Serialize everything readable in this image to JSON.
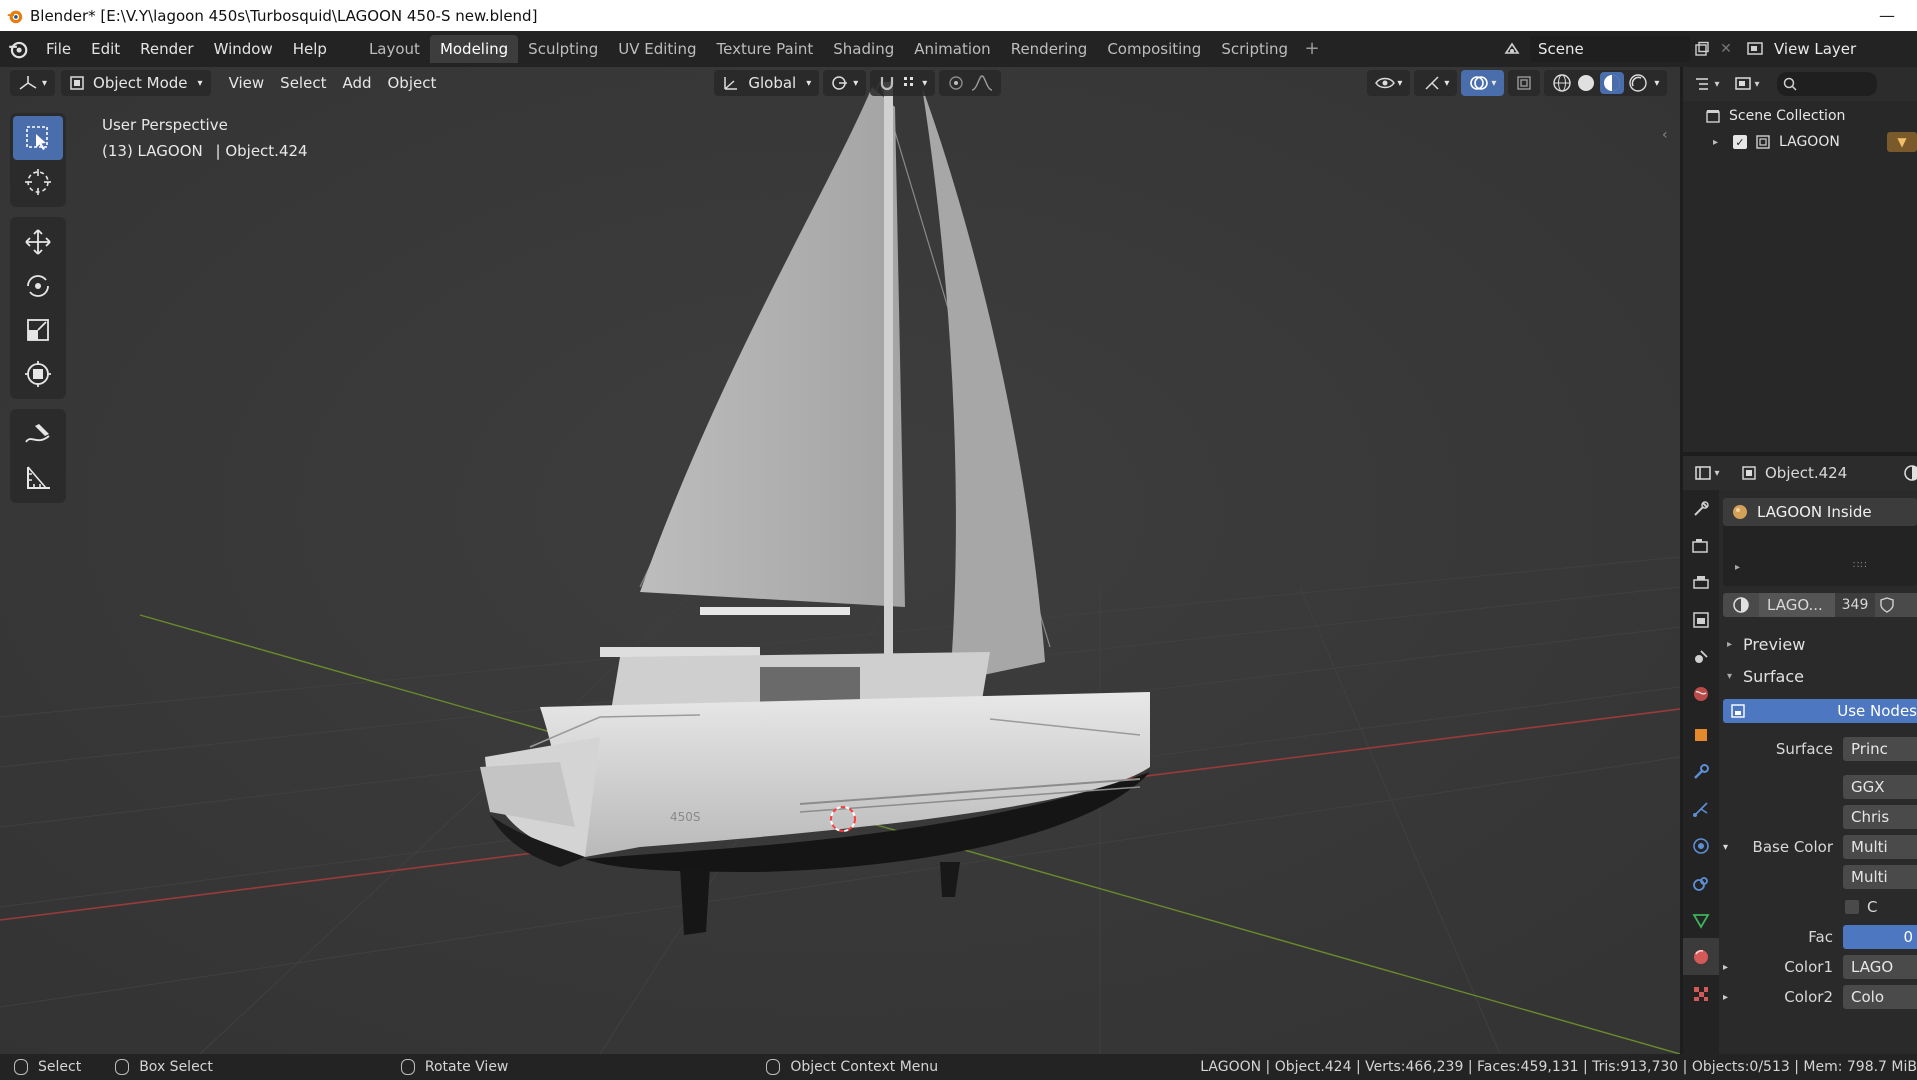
{
  "window": {
    "title": "Blender* [E:\\V.Y\\lagoon 450s\\Turbosquid\\LAGOON  450-S new.blend]",
    "minimize": "—"
  },
  "menu": [
    "File",
    "Edit",
    "Render",
    "Window",
    "Help"
  ],
  "workspaces": [
    {
      "label": "Layout",
      "active": false
    },
    {
      "label": "Modeling",
      "active": true
    },
    {
      "label": "Sculpting",
      "active": false
    },
    {
      "label": "UV Editing",
      "active": false
    },
    {
      "label": "Texture Paint",
      "active": false
    },
    {
      "label": "Shading",
      "active": false
    },
    {
      "label": "Animation",
      "active": false
    },
    {
      "label": "Rendering",
      "active": false
    },
    {
      "label": "Compositing",
      "active": false
    },
    {
      "label": "Scripting",
      "active": false
    }
  ],
  "workspace_add": "+",
  "scene": {
    "name": "Scene",
    "view_layer": "View Layer"
  },
  "viewport": {
    "mode": "Object Mode",
    "menus": [
      "View",
      "Select",
      "Add",
      "Object"
    ],
    "orientation": "Global",
    "perspective": "User Perspective",
    "context": "(13) LAGOON",
    "active_object": "| Object.424",
    "hull_text": "450S"
  },
  "outliner": {
    "root": "Scene Collection",
    "collection": "LAGOON"
  },
  "properties": {
    "object_name": "Object.424",
    "material_slot": "LAGOON  Inside",
    "material_name": "LAGO...",
    "user_count": "349",
    "sections": {
      "preview": "Preview",
      "surface": "Surface"
    },
    "use_nodes": "Use Nodes",
    "rows": [
      {
        "label": "Surface",
        "value": "Princ"
      },
      {
        "label": "",
        "value": "GGX"
      },
      {
        "label": "",
        "value": "Chris"
      },
      {
        "label": "Base Color",
        "value": "Multi"
      },
      {
        "label": "",
        "value": "Multi"
      },
      {
        "label": "",
        "value": "C"
      },
      {
        "label": "Fac",
        "value": "0"
      },
      {
        "label": "Color1",
        "value": "LAGO"
      },
      {
        "label": "Color2",
        "value": "Colo"
      }
    ]
  },
  "status": {
    "select": "Select",
    "box_select": "Box Select",
    "rotate_view": "Rotate View",
    "context_menu": "Object Context Menu",
    "stats": "LAGOON   | Object.424 | Verts:466,239 | Faces:459,131 | Tris:913,730 | Objects:0/513 | Mem: 798.7 MiB"
  },
  "colors": {
    "accent": "#4a6eab",
    "viewport_bg": "#393939",
    "x_axis": "#9a3b3b",
    "y_axis": "#6b8a2c"
  }
}
